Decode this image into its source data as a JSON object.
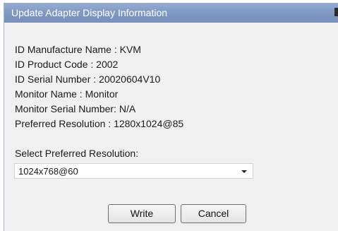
{
  "window": {
    "title": "Update Adapter Display Information"
  },
  "info": {
    "manufacture_name": "ID Manufacture Name : KVM",
    "product_code": "ID Product Code : 2002",
    "serial_number": "ID Serial Number : 20020604V10",
    "monitor_name": "Monitor Name : Monitor",
    "monitor_serial": "Monitor Serial Number: N/A",
    "preferred_resolution": "Preferred Resolution : 1280x1024@85"
  },
  "resolution_select": {
    "label": "Select Preferred Resolution:",
    "selected_value": "1024x768@60"
  },
  "buttons": {
    "write_label": "Write",
    "cancel_label": "Cancel"
  },
  "colors": {
    "title_bar": "#8ea4cb",
    "dialog_background": "#f0f0f0"
  }
}
